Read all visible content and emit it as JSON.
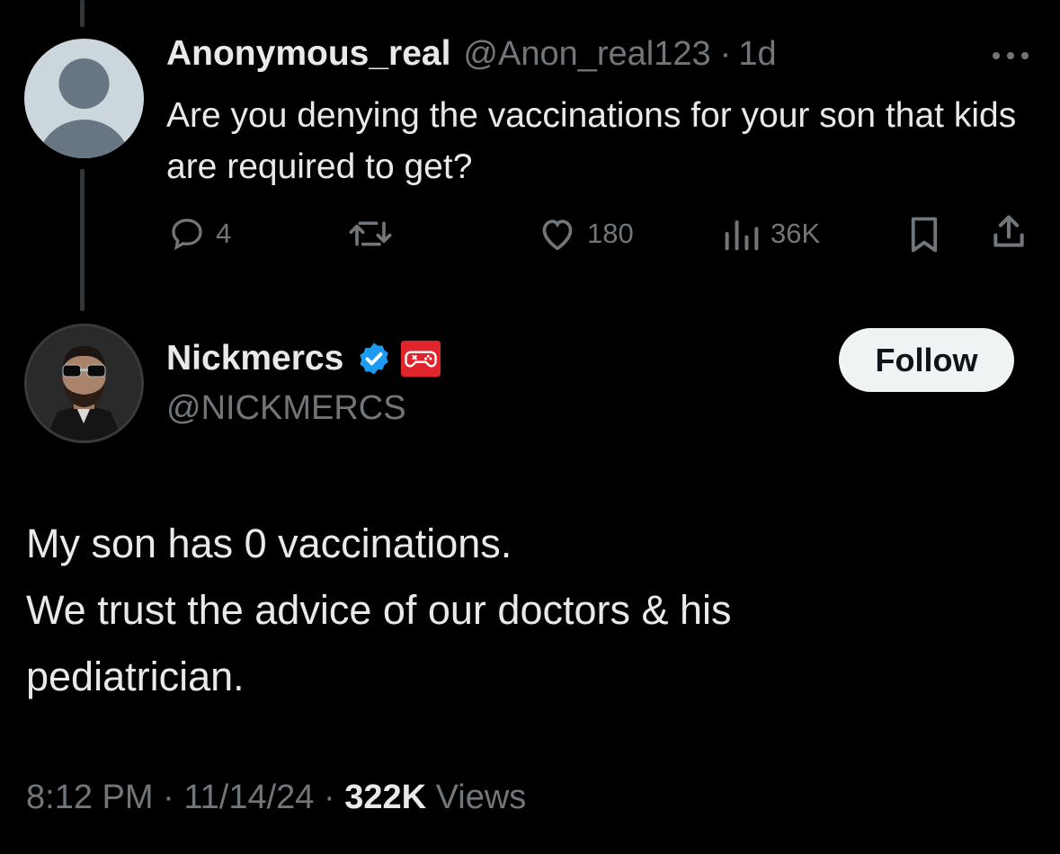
{
  "reply": {
    "author_name": "Anonymous_real",
    "author_handle": "@Anon_real123",
    "separator": "·",
    "time_ago": "1d",
    "more_label": "···",
    "text": "Are you denying the vaccinations for your son that kids are required to get?",
    "actions": {
      "replies": "4",
      "retweets": "",
      "likes": "180",
      "views": "36K"
    }
  },
  "main": {
    "author_name": "Nickmercs",
    "author_handle": "@NICKMERCS",
    "follow_label": "Follow",
    "text_lines": [
      "My son has 0 vaccinations.",
      "We trust the advice of our doctors & his pediatrician."
    ],
    "time": "8:12 PM",
    "date": "11/14/24",
    "views_count": "322K",
    "views_label": "Views",
    "dot": "·"
  },
  "colors": {
    "background": "#000000",
    "text": "#e7e9ea",
    "muted": "#71767b",
    "verified": "#1d9bf0",
    "gaming_badge": "#e0242b"
  },
  "icons": [
    "reply-icon",
    "retweet-icon",
    "like-icon",
    "views-icon",
    "bookmark-icon",
    "share-icon",
    "verified-badge-icon",
    "gaming-badge-icon",
    "more-icon"
  ]
}
